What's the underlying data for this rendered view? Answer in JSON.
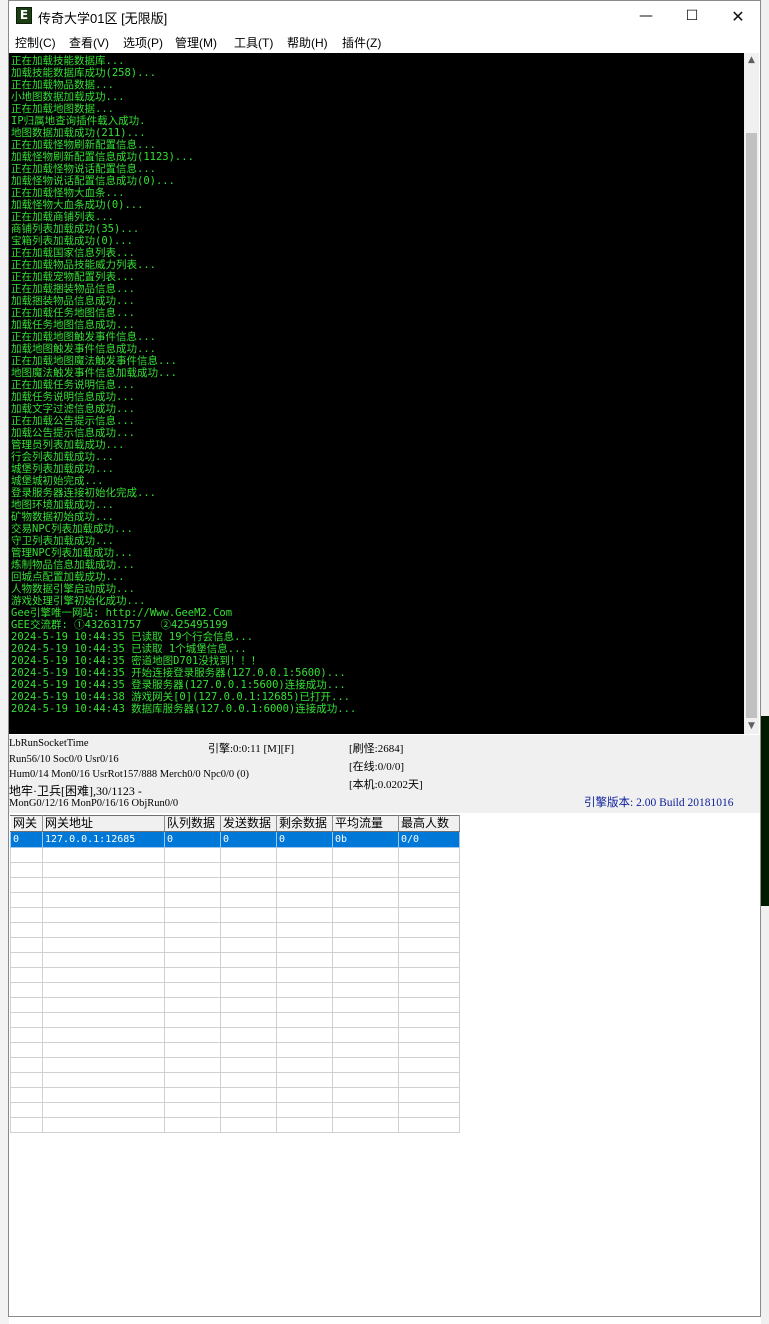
{
  "window": {
    "title": "传奇大学01区 [无限版]",
    "icon": "E"
  },
  "menu": [
    "控制(C)",
    "查看(V)",
    "选项(P)",
    "管理(M)",
    "工具(T)",
    "帮助(H)",
    "插件(Z)"
  ],
  "console": {
    "text_color": "#35e035",
    "background": "#000000",
    "lines": [
      "正在加载技能数据库...",
      "加载技能数据库成功(258)...",
      "正在加载物品数据...",
      "小地图数据加载成功...",
      "正在加载地图数据...",
      "IP归属地查询插件载入成功.",
      "地图数据加载成功(211)...",
      "正在加载怪物刷新配置信息...",
      "加载怪物刷新配置信息成功(1123)...",
      "正在加载怪物说话配置信息...",
      "加载怪物说话配置信息成功(0)...",
      "正在加载怪物大血条...",
      "加载怪物大血条成功(0)...",
      "正在加载商铺列表...",
      "商铺列表加载成功(35)...",
      "宝箱列表加载成功(0)...",
      "正在加载国家信息列表...",
      "正在加载物品技能威力列表...",
      "正在加载宠物配置列表...",
      "正在加载捆装物品信息...",
      "加载捆装物品信息成功...",
      "正在加载任务地图信息...",
      "加载任务地图信息成功...",
      "正在加载地图触发事件信息...",
      "加载地图触发事件信息成功...",
      "正在加载地图魔法触发事件信息...",
      "地图魔法触发事件信息加载成功...",
      "正在加载任务说明信息...",
      "加载任务说明信息成功...",
      "加载文字过滤信息成功...",
      "正在加载公告提示信息...",
      "加载公告提示信息成功...",
      "管理员列表加载成功...",
      "行会列表加载成功...",
      "城堡列表加载成功...",
      "城堡城初始完成...",
      "登录服务器连接初始化完成...",
      "地图环境加载成功...",
      "矿物数据初始成功...",
      "交易NPC列表加载成功...",
      "守卫列表加载成功...",
      "管理NPC列表加载成功...",
      "炼制物品信息加载成功...",
      "回城点配置加载成功...",
      "人物数据引擎启动成功...",
      "游戏处理引擎初始化成功...",
      "Gee引擎唯一网站: http://Www.GeeM2.Com",
      "GEE交流群: ①432631757   ②425495199",
      "2024-5-19 10:44:35 已读取 19个行会信息...",
      "2024-5-19 10:44:35 已读取 1个城堡信息...",
      "2024-5-19 10:44:35 密道地图D701没找到！！！",
      "2024-5-19 10:44:35 开始连接登录服务器(127.0.0.1:5600)...",
      "2024-5-19 10:44:35 登录服务器(127.0.0.1:5600)连接成功...",
      "2024-5-19 10:44:38 游戏网关[0](127.0.0.1:12685)已打开...",
      "2024-5-19 10:44:43 数据库服务器(127.0.0.1:6000)连接成功..."
    ]
  },
  "status": {
    "lb_run": "LbRunSocketTime",
    "engine_time": "引擎:0:0:11 [M][F]",
    "monster_refresh": "[刷怪:2684]",
    "run_line": "Run56/10 Soc0/0 Usr0/16",
    "online": "[在线:0/0/0]",
    "hum_line": "Hum0/14 Mon0/16 UsrRot157/888 Merch0/0 Npc0/0 (0)",
    "local_time": "[本机:0.0202天]",
    "map_line": "地牢·卫兵[困难],30/1123 -",
    "mon_line": "MonG0/12/16 MonP0/16/16 ObjRun0/0",
    "version": "引擎版本: 2.00 Build 20181016"
  },
  "gateway_table": {
    "headers": [
      "网关",
      "网关地址",
      "队列数据",
      "发送数据",
      "剩余数据",
      "平均流量",
      "最高人数"
    ],
    "rows": [
      [
        "0",
        "127.0.0.1:12685",
        "0",
        "0",
        "0",
        "0b",
        "0/0"
      ]
    ],
    "empty_rows": 19
  },
  "icons": [
    "app-icon",
    "minimize-icon",
    "maximize-icon",
    "close-icon",
    "scroll-up-icon",
    "scroll-down-icon"
  ]
}
